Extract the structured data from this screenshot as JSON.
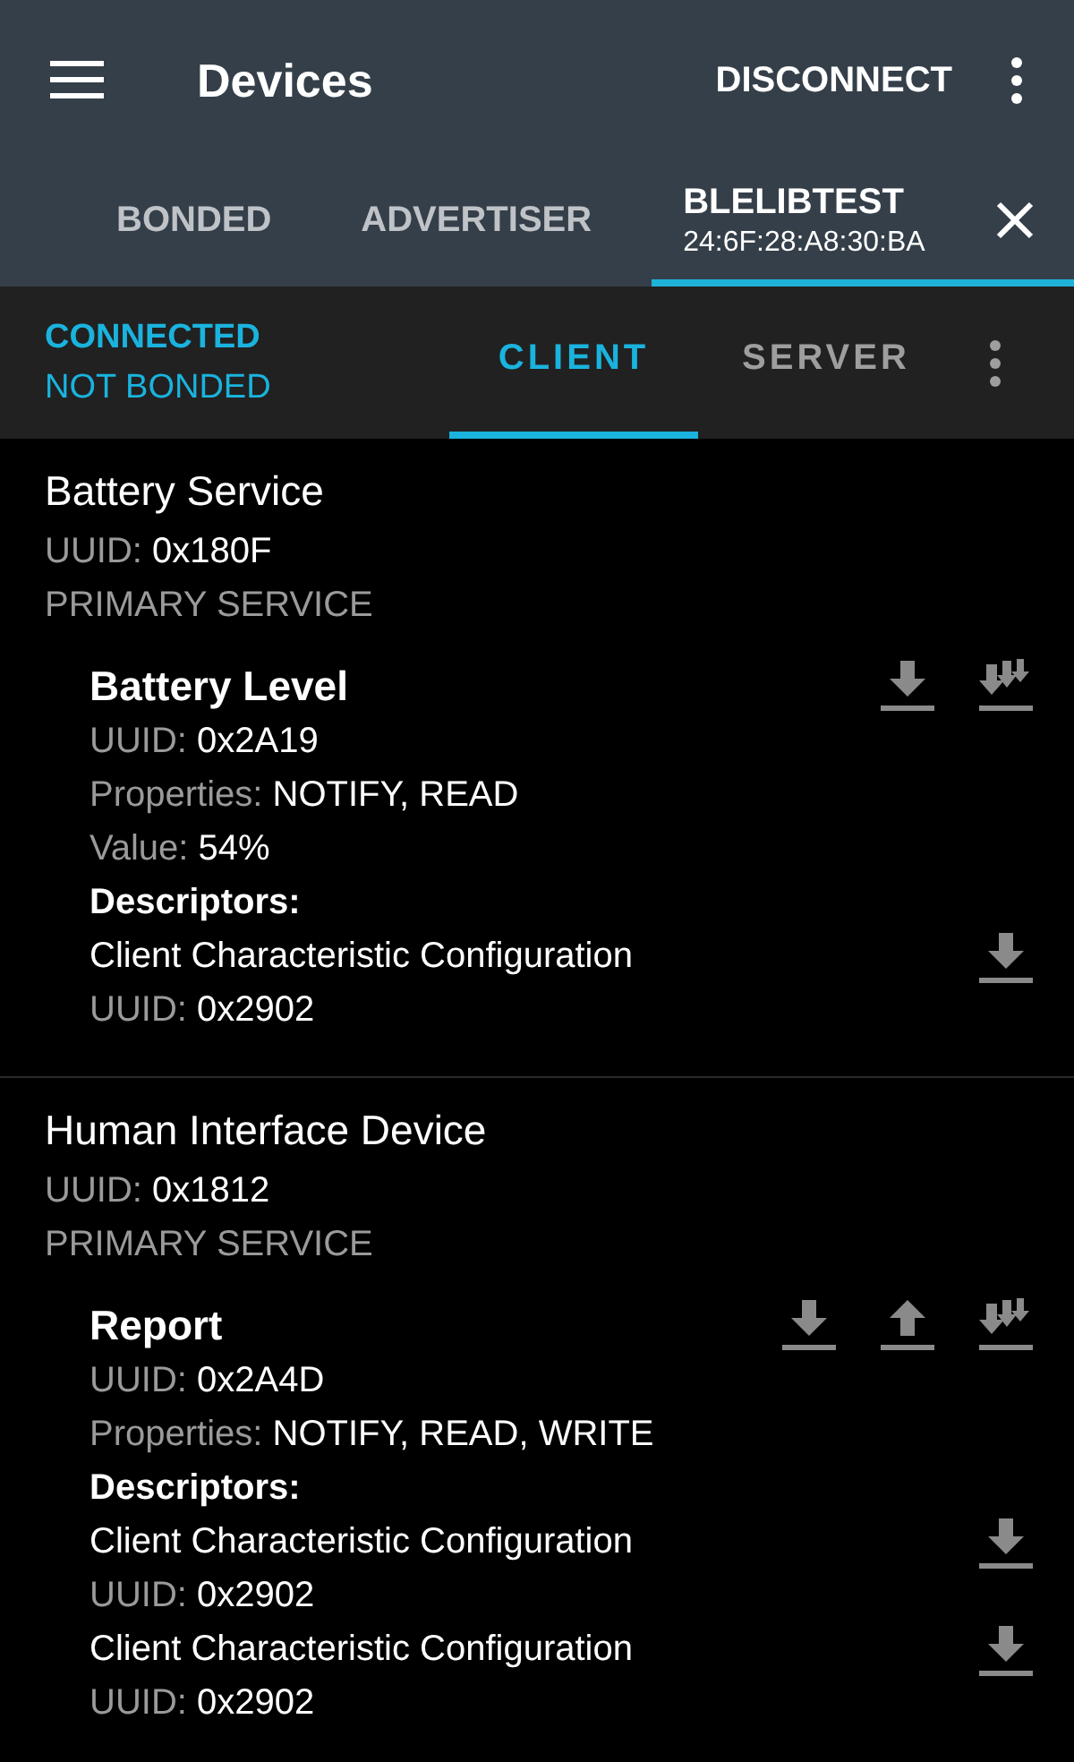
{
  "app_bar": {
    "title": "Devices",
    "action": "DISCONNECT"
  },
  "device_tabs": [
    {
      "label": "BONDED",
      "selected": false
    },
    {
      "label": "ADVERTISER",
      "selected": false
    },
    {
      "label": "BLELIBTEST",
      "subtitle": "24:6F:28:A8:30:BA",
      "selected": true,
      "closable": true
    }
  ],
  "connection": {
    "state": "CONNECTED",
    "bond": "NOT BONDED"
  },
  "role_tabs": [
    {
      "label": "CLIENT",
      "selected": true
    },
    {
      "label": "SERVER",
      "selected": false
    }
  ],
  "services": [
    {
      "name": "Battery Service",
      "uuid": {
        "label": "UUID:",
        "value": "0x180F"
      },
      "type": "PRIMARY SERVICE",
      "characteristics": [
        {
          "name": "Battery Level",
          "actions": [
            {
              "kind": "read"
            },
            {
              "kind": "notify"
            }
          ],
          "fields": [
            {
              "label": "UUID:",
              "value": "0x2A19"
            },
            {
              "label": "Properties:",
              "value": "NOTIFY, READ"
            },
            {
              "label": "Value:",
              "value": "54%"
            }
          ],
          "descriptors_heading": "Descriptors:",
          "descriptors": [
            {
              "name": "Client Characteristic Configuration",
              "uuid": {
                "label": "UUID:",
                "value": "0x2902"
              },
              "actions": [
                {
                  "kind": "read"
                }
              ]
            }
          ]
        }
      ]
    },
    {
      "name": "Human Interface Device",
      "uuid": {
        "label": "UUID:",
        "value": "0x1812"
      },
      "type": "PRIMARY SERVICE",
      "characteristics": [
        {
          "name": "Report",
          "actions": [
            {
              "kind": "read"
            },
            {
              "kind": "write"
            },
            {
              "kind": "notify"
            }
          ],
          "fields": [
            {
              "label": "UUID:",
              "value": "0x2A4D"
            },
            {
              "label": "Properties:",
              "value": "NOTIFY, READ, WRITE"
            }
          ],
          "descriptors_heading": "Descriptors:",
          "descriptors": [
            {
              "name": "Client Characteristic Configuration",
              "uuid": {
                "label": "UUID:",
                "value": "0x2902"
              },
              "actions": [
                {
                  "kind": "read"
                }
              ]
            },
            {
              "name": "Client Characteristic Configuration",
              "uuid": {
                "label": "UUID:",
                "value": "0x2902"
              },
              "actions": [
                {
                  "kind": "read"
                }
              ]
            }
          ]
        }
      ]
    }
  ]
}
